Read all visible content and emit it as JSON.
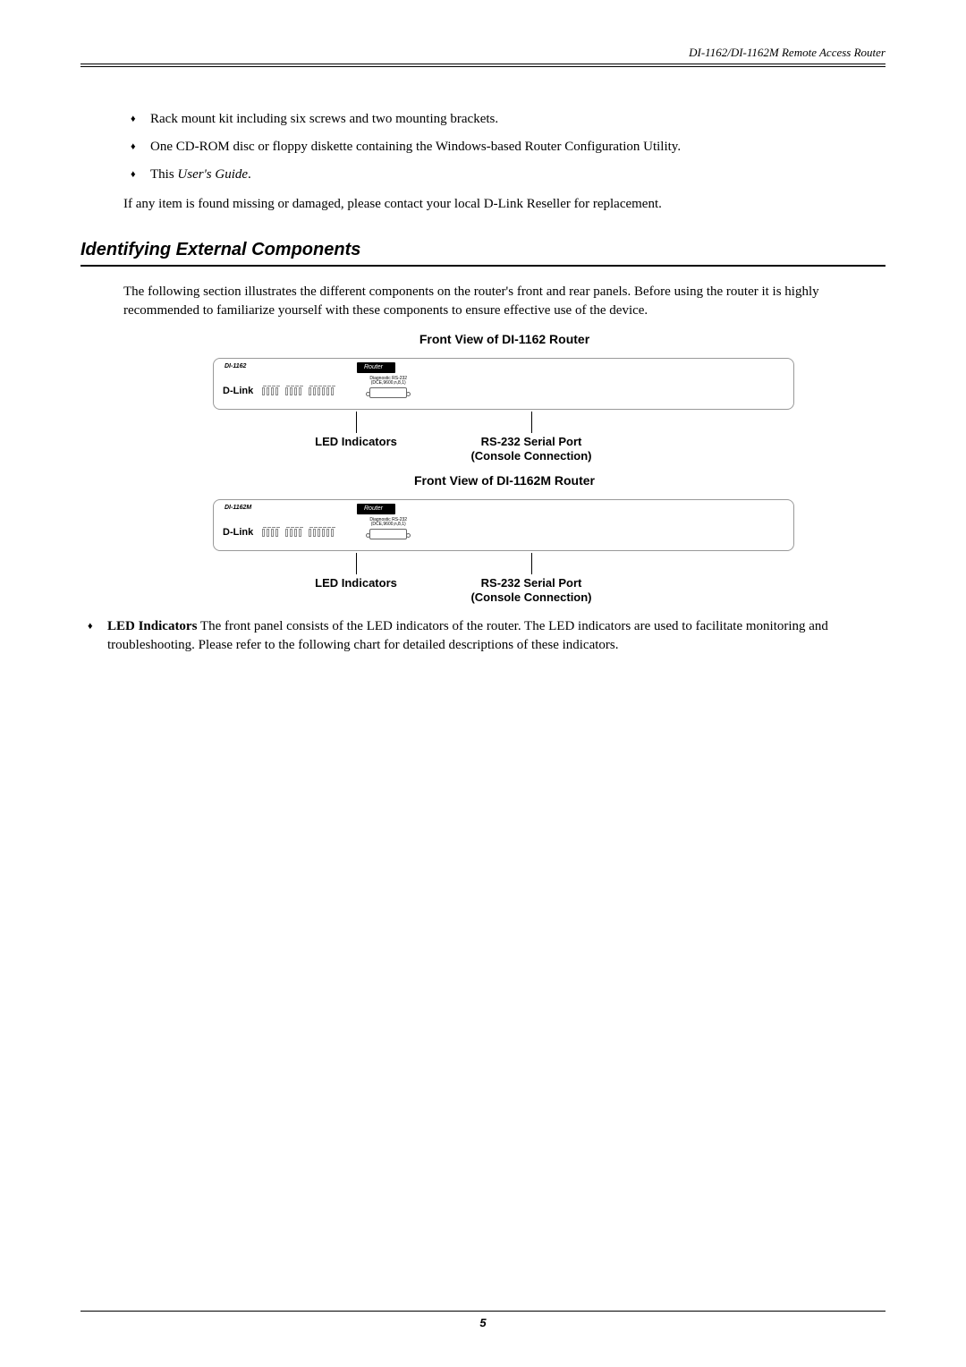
{
  "header": {
    "title": "DI-1162/DI-1162M Remote Access Router"
  },
  "bullets": {
    "item1": "Rack mount kit including six screws and two mounting brackets.",
    "item2": "One CD-ROM disc or floppy diskette containing the Windows-based Router Configuration Utility.",
    "item3_prefix": "This ",
    "item3_italic": "User's Guide",
    "item3_suffix": "."
  },
  "closing": "If any item is found missing or damaged, please contact your local D-Link Reseller for replacement.",
  "section": {
    "heading": "Identifying External Components",
    "intro": "The following section illustrates the different components on the router's front and rear panels. Before using the router it is highly recommended to familiarize yourself with these components to ensure effective use of the device."
  },
  "figures": {
    "caption1": "Front View of DI-1162 Router",
    "caption2": "Front View of DI-1162M Router",
    "model1": "DI-1162",
    "model2": "DI-1162M",
    "badge": "Router",
    "brand": "D-Link",
    "serial_tiny1": "Diagnostic RS-232",
    "serial_tiny2": "(DCE,9600,n,8,1)",
    "callout_led": "LED Indicators",
    "callout_serial1": "RS-232 Serial Port",
    "callout_serial2": "(Console Connection)"
  },
  "led_para": {
    "label": "LED Indicators",
    "text": "  The front panel consists of the LED indicators of the router. The LED indicators are used to facilitate monitoring and troubleshooting. Please refer to the following chart for detailed descriptions of these indicators."
  },
  "footer": {
    "page": "5"
  }
}
